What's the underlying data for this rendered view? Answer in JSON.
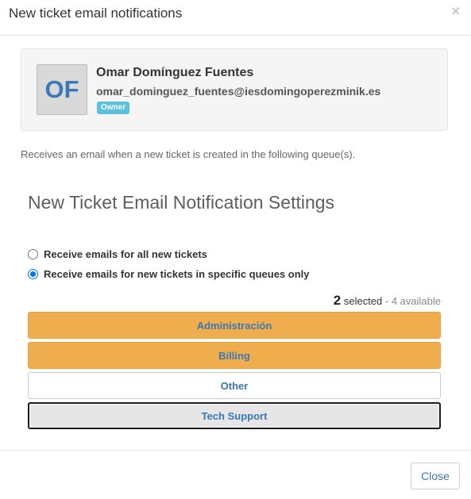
{
  "modal": {
    "title": "New ticket email notifications",
    "close_icon": "×"
  },
  "user": {
    "initials": "OF",
    "name": "Omar Domínguez Fuentes",
    "email": "omar_dominguez_fuentes@iesdomingoperezminik.es",
    "role": "Owner"
  },
  "description": "Receives an email when a new ticket is created in the following queue(s).",
  "settings": {
    "heading": "New Ticket Email Notification Settings",
    "options": [
      {
        "label": "Receive emails for all new tickets",
        "checked": false
      },
      {
        "label": "Receive emails for new tickets in specific queues only",
        "checked": true
      }
    ]
  },
  "counter": {
    "selected": "2",
    "selected_label": "selected",
    "available_label": "- 4 available"
  },
  "queues": [
    {
      "label": "Administración",
      "state": "selected"
    },
    {
      "label": "Billing",
      "state": "selected"
    },
    {
      "label": "Other",
      "state": "unselected"
    },
    {
      "label": "Tech Support",
      "state": "focused"
    }
  ],
  "footer": {
    "close_label": "Close"
  },
  "colors": {
    "selected_queue": "#f0ad4e",
    "badge": "#5bc0de",
    "link_text": "#3a78b6"
  }
}
